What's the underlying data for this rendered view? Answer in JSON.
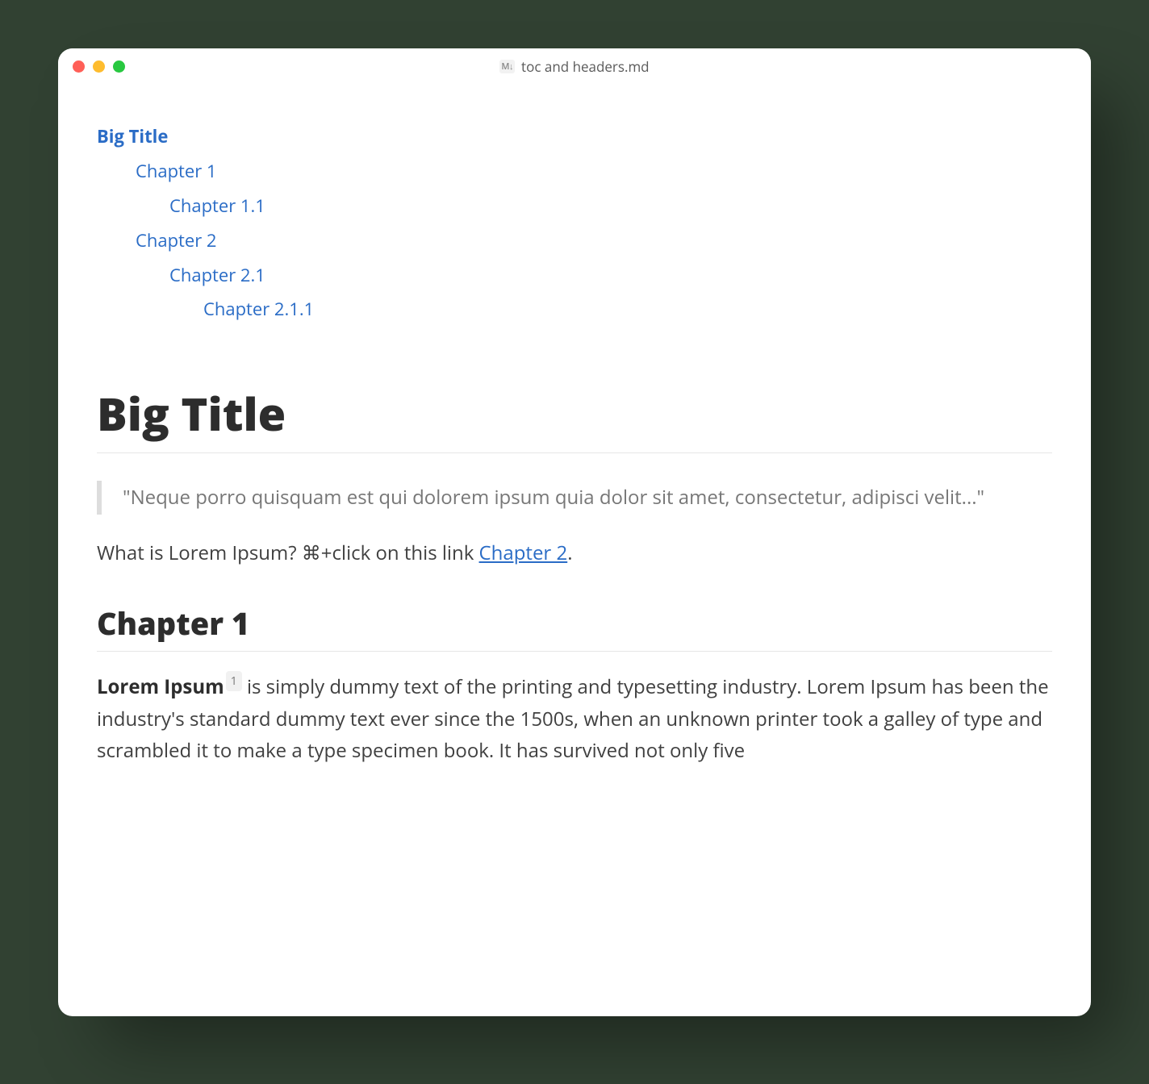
{
  "window": {
    "filetype_badge": "M↓",
    "filename": "toc and headers.md"
  },
  "toc": {
    "items": [
      {
        "level": 0,
        "label": "Big Title"
      },
      {
        "level": 1,
        "label": "Chapter 1"
      },
      {
        "level": 2,
        "label": "Chapter 1.1"
      },
      {
        "level": 1,
        "label": "Chapter 2"
      },
      {
        "level": 2,
        "label": "Chapter 2.1"
      },
      {
        "level": 3,
        "label": "Chapter 2.1.1"
      }
    ]
  },
  "doc": {
    "h1": "Big Title",
    "quote": "\"Neque porro quisquam est qui dolorem ipsum quia dolor sit amet, consectetur, adipisci velit...\"",
    "intro_prefix": "What is Lorem Ipsum? ⌘+click on this link ",
    "intro_link": "Chapter 2",
    "intro_suffix": ".",
    "chapter1_heading": "Chapter 1",
    "chapter1_strong": "Lorem Ipsum",
    "footnote_marker": "1",
    "chapter1_body": " is simply dummy text of the printing and typesetting industry. Lorem Ipsum has been the industry's standard dummy text ever since the 1500s, when an unknown printer took a galley of type and scrambled it to make a type specimen book. It has survived not only five"
  }
}
